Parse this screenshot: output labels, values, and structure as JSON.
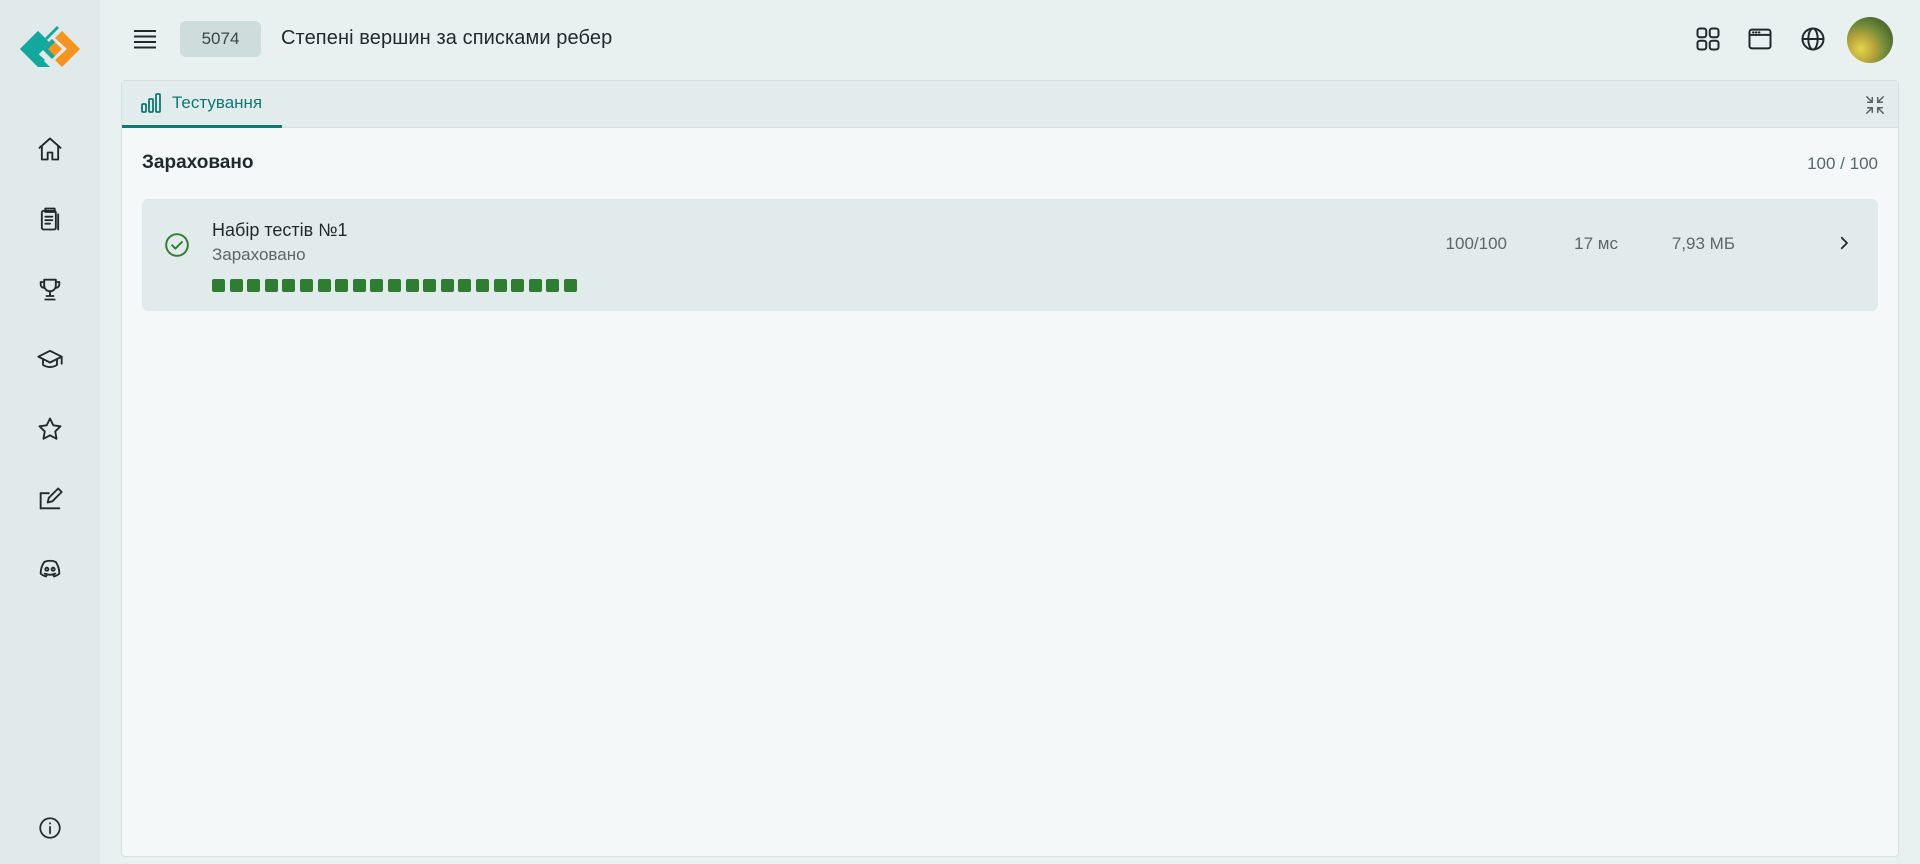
{
  "header": {
    "problem_id": "5074",
    "problem_title": "Степені вершин за списками ребер"
  },
  "sidebar": {
    "items": [
      {
        "icon": "home-icon"
      },
      {
        "icon": "clipboard-list-icon"
      },
      {
        "icon": "trophy-icon"
      },
      {
        "icon": "graduation-cap-icon"
      },
      {
        "icon": "star-icon"
      },
      {
        "icon": "edit-icon"
      },
      {
        "icon": "discord-icon"
      }
    ],
    "info_icon": "info-icon"
  },
  "toolbar_icons": [
    "apps-grid-icon",
    "browser-window-icon",
    "globe-icon"
  ],
  "panel": {
    "tab_label": "Тестування",
    "verdict": "Зараховано",
    "score": "100 / 100"
  },
  "testsets": [
    {
      "name": "Набір тестів №1",
      "status": "Зараховано",
      "score": "100/100",
      "time": "17 мс",
      "memory": "7,93 МБ",
      "tests_passed": 21,
      "tests_total": 21
    }
  ],
  "colors": {
    "accent": "#0b7a6f",
    "success": "#2e7d32",
    "background": "#e8f1f0"
  }
}
